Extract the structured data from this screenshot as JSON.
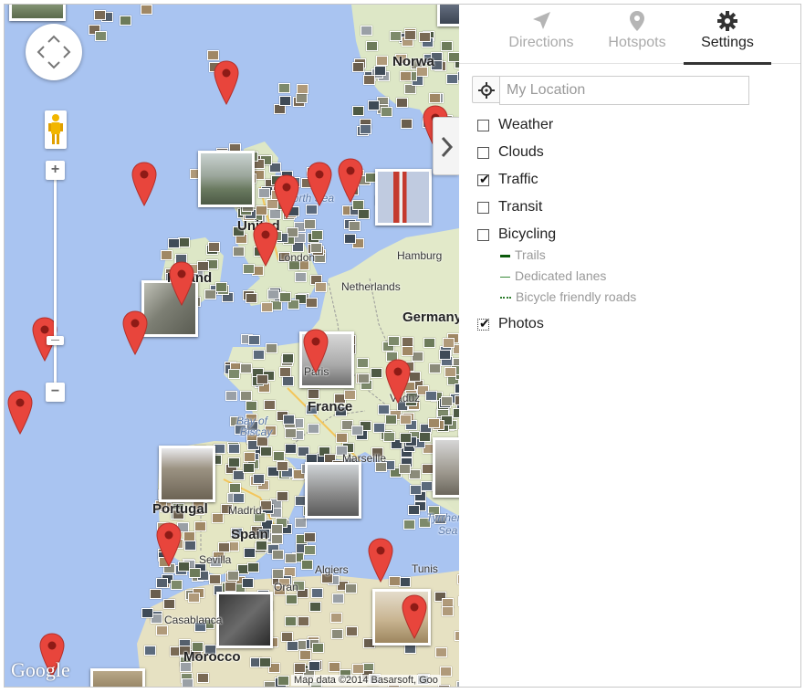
{
  "map": {
    "labels": [
      {
        "text": "Norwa",
        "cls": "big"
      },
      {
        "text": "North Sea",
        "cls": "sea"
      },
      {
        "text": "United",
        "cls": "big"
      },
      {
        "text": "Ireland",
        "cls": "big"
      },
      {
        "text": "Netherlands",
        "cls": ""
      },
      {
        "text": "Germany",
        "cls": "big"
      },
      {
        "text": "France",
        "cls": "big"
      },
      {
        "text": "Bay of",
        "cls": "sea"
      },
      {
        "text": "Biscay",
        "cls": "sea"
      },
      {
        "text": "Marseille",
        "cls": ""
      },
      {
        "text": "Portugal",
        "cls": "big"
      },
      {
        "text": "Madrid",
        "cls": ""
      },
      {
        "text": "Spain",
        "cls": "big"
      },
      {
        "text": "Sevilla",
        "cls": ""
      },
      {
        "text": "Oran",
        "cls": ""
      },
      {
        "text": "Algiers",
        "cls": ""
      },
      {
        "text": "Tunis",
        "cls": ""
      },
      {
        "text": "Tyrrhenian",
        "cls": "sea"
      },
      {
        "text": "Sea",
        "cls": "sea"
      },
      {
        "text": "Casablanca",
        "cls": ""
      },
      {
        "text": "Morocco",
        "cls": "big"
      },
      {
        "text": "Hamburg",
        "cls": ""
      },
      {
        "text": "London",
        "cls": ""
      },
      {
        "text": "Paris",
        "cls": ""
      },
      {
        "text": "Vaduz",
        "cls": ""
      }
    ],
    "google_logo": "Google",
    "attribution": "Map data ©2014 Basarsoft, Goo",
    "zoom_in": "+",
    "zoom_out": "−"
  },
  "panel": {
    "tabs": [
      {
        "label": "Directions",
        "icon": "directions-arrow-icon",
        "active": false
      },
      {
        "label": "Hotspots",
        "icon": "location-pin-icon",
        "active": false
      },
      {
        "label": "Settings",
        "icon": "gear-icon",
        "active": true
      }
    ],
    "location": {
      "placeholder": "My Location",
      "value": ""
    },
    "options": [
      {
        "label": "Weather",
        "checked": false
      },
      {
        "label": "Clouds",
        "checked": false
      },
      {
        "label": "Traffic",
        "checked": true
      },
      {
        "label": "Transit",
        "checked": false
      },
      {
        "label": "Bicycling",
        "checked": false
      }
    ],
    "bike_legend": [
      {
        "label": "Trails",
        "style": "solid-dark"
      },
      {
        "label": "Dedicated lanes",
        "style": "solid-light"
      },
      {
        "label": "Bicycle friendly roads",
        "style": "dotted"
      }
    ],
    "photos_option": {
      "label": "Photos",
      "checked": true
    },
    "colors": {
      "accent": "#333333",
      "trail": "#0b5a0b",
      "lane": "#3a8a3a",
      "friendly": "#2e7d2e",
      "pin": "#e8453c",
      "water": "#a8c3f0",
      "land": "#dfe8c8"
    }
  }
}
